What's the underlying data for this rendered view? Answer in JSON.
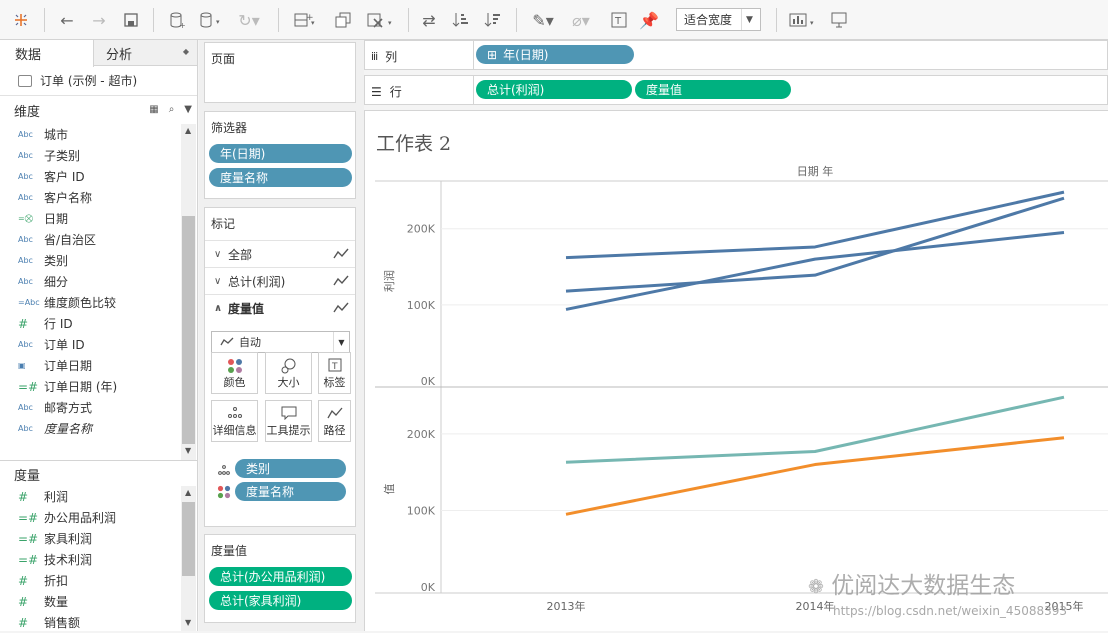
{
  "toolbar": {
    "fit_label": "适合宽度"
  },
  "left_panel": {
    "tab_data": "数据",
    "tab_analysis": "分析",
    "datasource": "订单 (示例 - 超市)",
    "dimensions_title": "维度",
    "dimensions": [
      {
        "icon": "Abc",
        "label": "城市"
      },
      {
        "icon": "Abc",
        "label": "子类别"
      },
      {
        "icon": "Abc",
        "label": "客户 ID"
      },
      {
        "icon": "Abc",
        "label": "客户名称"
      },
      {
        "icon": "=⛒",
        "label": "日期"
      },
      {
        "icon": "Abc",
        "label": "省/自治区"
      },
      {
        "icon": "Abc",
        "label": "类别"
      },
      {
        "icon": "Abc",
        "label": "细分"
      },
      {
        "icon": "=Abc",
        "label": "维度颜色比较"
      },
      {
        "icon": "#",
        "label": "行 ID"
      },
      {
        "icon": "Abc",
        "label": "订单 ID"
      },
      {
        "icon": "▣",
        "label": "订单日期"
      },
      {
        "icon": "=#",
        "label": "订单日期 (年)"
      },
      {
        "icon": "Abc",
        "label": "邮寄方式"
      },
      {
        "icon": "Abc",
        "label": "度量名称"
      }
    ],
    "measures_title": "度量",
    "measures": [
      {
        "icon": "#",
        "label": "利润"
      },
      {
        "icon": "=#",
        "label": "办公用品利润"
      },
      {
        "icon": "=#",
        "label": "家具利润"
      },
      {
        "icon": "=#",
        "label": "技术利润"
      },
      {
        "icon": "#",
        "label": "折扣"
      },
      {
        "icon": "#",
        "label": "数量"
      },
      {
        "icon": "#",
        "label": "销售额"
      }
    ]
  },
  "cards": {
    "pages_title": "页面",
    "filters_title": "筛选器",
    "filters": [
      "年(日期)",
      "度量名称"
    ],
    "marks_title": "标记",
    "marks_rows": [
      "全部",
      "总计(利润)",
      "度量值"
    ],
    "mark_type": "自动",
    "mark_buttons": [
      "颜色",
      "大小",
      "标签",
      "详细信息",
      "工具提示",
      "路径"
    ],
    "mark_pills": [
      "类别",
      "度量名称"
    ],
    "measure_values_title": "度量值",
    "measure_values": [
      "总计(办公用品利润)",
      "总计(家具利润)"
    ]
  },
  "shelves": {
    "columns_label": "列",
    "columns_pill": "年(日期)",
    "rows_label": "行",
    "rows_pills": [
      "总计(利润)",
      "度量值"
    ]
  },
  "view": {
    "sheet_title": "工作表 2",
    "header_label": "日期 年",
    "top_axis_label": "利润",
    "bottom_axis_label": "值",
    "y_ticks": [
      "0K",
      "100K",
      "200K"
    ],
    "x_labels": [
      "2013年",
      "2014年",
      "2015年"
    ]
  },
  "chart_data": [
    {
      "type": "line",
      "categories": [
        "2013年",
        "2014年",
        "2015年"
      ],
      "ylabel": "利润",
      "ylim": [
        0,
        260000
      ],
      "series": [
        {
          "values": [
            162000,
            176000,
            248000
          ],
          "color": "#4e79a7"
        },
        {
          "values": [
            118000,
            139000,
            240000
          ],
          "color": "#4e79a7"
        },
        {
          "values": [
            94000,
            160000,
            195000
          ],
          "color": "#4e79a7"
        }
      ]
    },
    {
      "type": "line",
      "categories": [
        "2013年",
        "2014年",
        "2015年"
      ],
      "ylabel": "值",
      "ylim": [
        0,
        260000
      ],
      "series": [
        {
          "values": [
            163000,
            177000,
            248000
          ],
          "color": "#76b7b2"
        },
        {
          "values": [
            95000,
            160000,
            195000
          ],
          "color": "#f28e2b"
        }
      ]
    }
  ],
  "watermark": {
    "text": "优阅达大数据生态",
    "url": "https://blog.csdn.net/weixin_45088393"
  }
}
